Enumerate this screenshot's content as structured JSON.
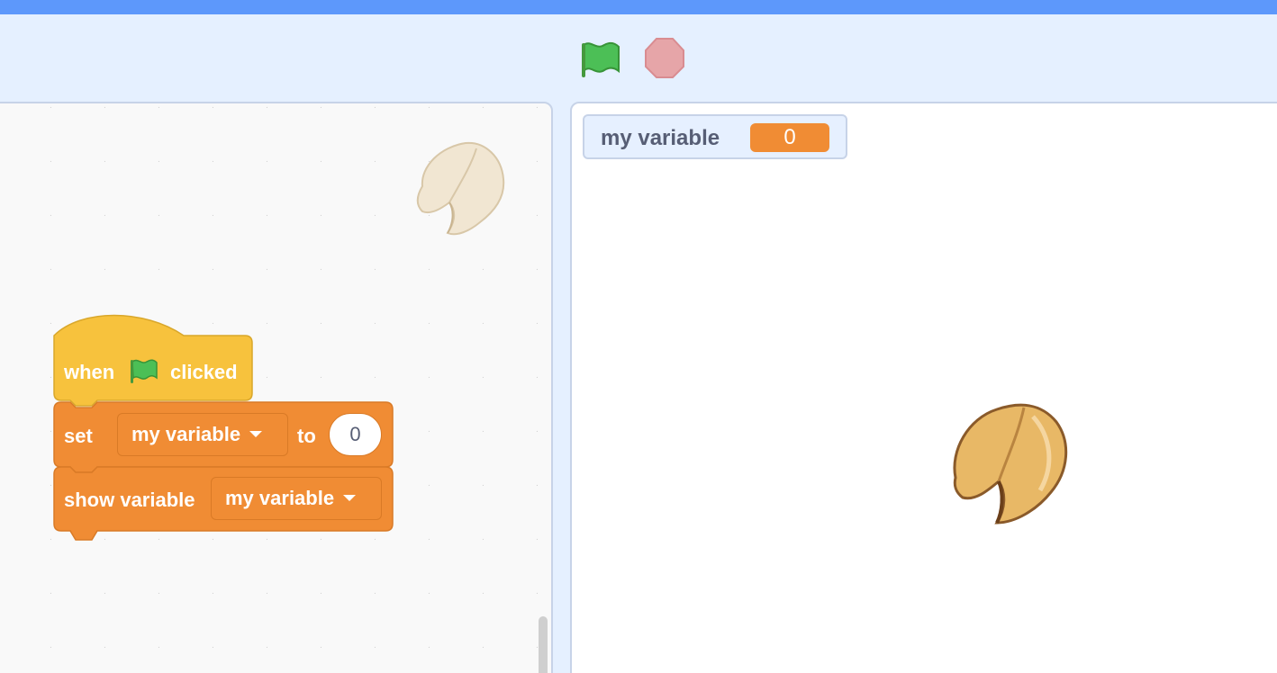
{
  "controls": {
    "green_flag_icon": "green-flag-icon",
    "stop_icon": "stop-sign-icon",
    "colors": {
      "flag": "#4cbf56",
      "stop": "#e6a5a8",
      "menubar": "#5d98fb"
    }
  },
  "workspace": {
    "sprite_icon": "fortune-cookie-icon",
    "script": {
      "hat": {
        "before": "when",
        "icon": "green-flag-icon",
        "after": "clicked",
        "color": "#f7c23d"
      },
      "set_block": {
        "label": "set",
        "variable": "my variable",
        "to_label": "to",
        "value": "0",
        "color": "#f08c34"
      },
      "show_block": {
        "label": "show variable",
        "variable": "my variable",
        "color": "#f08c34"
      }
    }
  },
  "stage": {
    "monitor": {
      "label": "my variable",
      "value": "0"
    },
    "sprite_icon": "fortune-cookie-icon"
  }
}
